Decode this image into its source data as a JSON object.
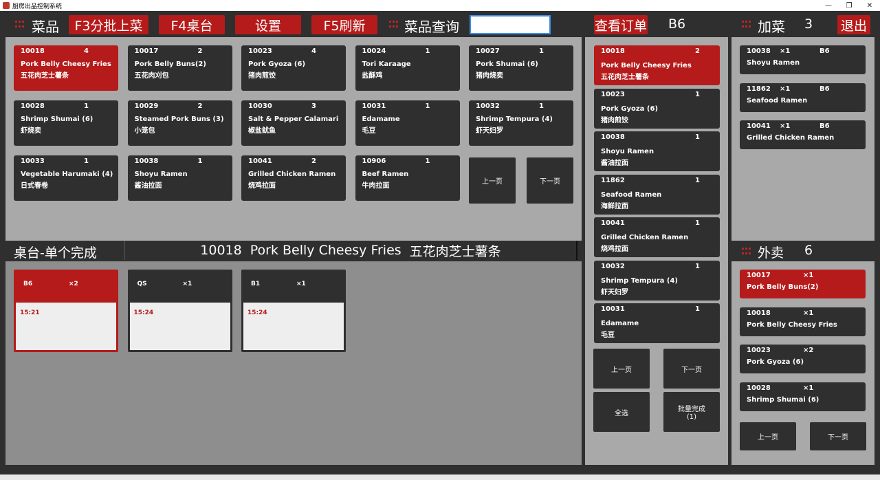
{
  "window": {
    "title": "厨房出品控制系统"
  },
  "toolbar": {
    "dish_label": "菜品",
    "btn_batch": "F3分批上菜",
    "btn_table": "F4桌台",
    "btn_settings": "设置",
    "btn_refresh": "F5刷新",
    "query_label": "菜品查询",
    "search_value": "",
    "btn_view_order": "查看订单",
    "current_table": "B6",
    "add_label": "加菜",
    "add_count": "3",
    "btn_exit": "退出"
  },
  "dishes": [
    {
      "code": "10018",
      "qty": "4",
      "en": "Pork Belly Cheesy Fries",
      "zh": "五花肉芝士薯条",
      "active": true
    },
    {
      "code": "10017",
      "qty": "2",
      "en": "Pork Belly Buns(2)",
      "zh": "五花肉刈包"
    },
    {
      "code": "10023",
      "qty": "4",
      "en": "Pork Gyoza (6)",
      "zh": "猪肉煎饺"
    },
    {
      "code": "10024",
      "qty": "1",
      "en": "Tori Karaage",
      "zh": "盐酥鸡"
    },
    {
      "code": "10027",
      "qty": "1",
      "en": "Pork Shumai (6)",
      "zh": "猪肉烧卖"
    },
    {
      "code": "10028",
      "qty": "1",
      "en": "Shrimp Shumai (6)",
      "zh": "虾烧卖"
    },
    {
      "code": "10029",
      "qty": "2",
      "en": "Steamed Pork Buns (3)",
      "zh": "小笼包"
    },
    {
      "code": "10030",
      "qty": "3",
      "en": "Salt & Pepper Calamari",
      "zh": "椒盐鱿鱼"
    },
    {
      "code": "10031",
      "qty": "1",
      "en": "Edamame",
      "zh": "毛豆"
    },
    {
      "code": "10032",
      "qty": "1",
      "en": "Shrimp Tempura (4)",
      "zh": "虾天妇罗"
    },
    {
      "code": "10033",
      "qty": "1",
      "en": "Vegetable Harumaki (4)",
      "zh": "日式春卷"
    },
    {
      "code": "10038",
      "qty": "1",
      "en": "Shoyu Ramen",
      "zh": "酱油拉面"
    },
    {
      "code": "10041",
      "qty": "2",
      "en": "Grilled Chicken Ramen",
      "zh": "烧鸡拉面"
    },
    {
      "code": "10906",
      "qty": "1",
      "en": "Beef Ramen",
      "zh": "牛肉拉面"
    }
  ],
  "dish_pager": {
    "prev": "上一页",
    "next": "下一页"
  },
  "table_section": {
    "title": "桌台-单个完成",
    "selected_code": "10018",
    "selected_en": "Pork Belly Cheesy Fries",
    "selected_zh": "五花肉芝士薯条",
    "tables": [
      {
        "name": "B6",
        "qty": "×2",
        "time": "15:21",
        "active": true
      },
      {
        "name": "QS",
        "qty": "×1",
        "time": "15:24"
      },
      {
        "name": "B1",
        "qty": "×1",
        "time": "15:24"
      }
    ]
  },
  "orders": [
    {
      "code": "10018",
      "qty": "2",
      "en": "Pork Belly Cheesy Fries",
      "zh": "五花肉芝士薯条",
      "active": true
    },
    {
      "code": "10023",
      "qty": "1",
      "en": "Pork Gyoza (6)",
      "zh": "猪肉煎饺"
    },
    {
      "code": "10038",
      "qty": "1",
      "en": "Shoyu Ramen",
      "zh": "酱油拉面"
    },
    {
      "code": "11862",
      "qty": "1",
      "en": "Seafood Ramen",
      "zh": "海鲜拉面"
    },
    {
      "code": "10041",
      "qty": "1",
      "en": "Grilled Chicken Ramen",
      "zh": "烧鸡拉面"
    },
    {
      "code": "10032",
      "qty": "1",
      "en": "Shrimp Tempura (4)",
      "zh": "虾天妇罗"
    },
    {
      "code": "10031",
      "qty": "1",
      "en": "Edamame",
      "zh": "毛豆"
    }
  ],
  "order_pager": {
    "prev": "上一页",
    "next": "下一页",
    "select_all": "全选",
    "batch_done": "批量完成",
    "batch_count": "(1)"
  },
  "add_items": [
    {
      "code": "10038",
      "qty": "×1",
      "table": "B6",
      "en": "Shoyu Ramen"
    },
    {
      "code": "11862",
      "qty": "×1",
      "table": "B6",
      "en": "Seafood Ramen"
    },
    {
      "code": "10041",
      "qty": "×1",
      "table": "B6",
      "en": "Grilled Chicken Ramen"
    }
  ],
  "takeout": {
    "label": "外卖",
    "count": "6",
    "items": [
      {
        "code": "10017",
        "qty": "×1",
        "en": "Pork Belly Buns(2)",
        "active": true
      },
      {
        "code": "10018",
        "qty": "×1",
        "en": "Pork Belly Cheesy Fries"
      },
      {
        "code": "10023",
        "qty": "×2",
        "en": "Pork Gyoza (6)"
      },
      {
        "code": "10028",
        "qty": "×1",
        "en": "Shrimp Shumai (6)"
      }
    ],
    "prev": "上一页",
    "next": "下一页"
  },
  "colors": {
    "accent": "#b51b1b",
    "dark": "#2f2f2f",
    "panel": "#a9a9a9"
  }
}
